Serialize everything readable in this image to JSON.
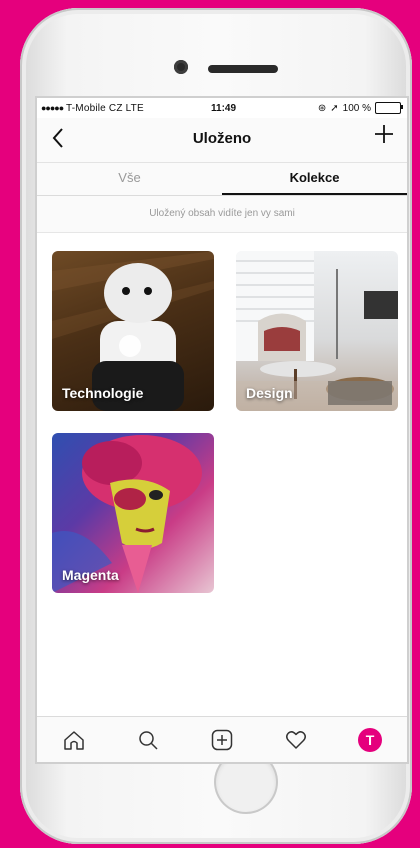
{
  "status_bar": {
    "carrier": "T-Mobile CZ",
    "network": "LTE",
    "time": "11:49",
    "battery": "100 %",
    "battery_level": 1.0
  },
  "header": {
    "back_icon": "chevron-left-icon",
    "title": "Uloženo",
    "add_icon": "plus-icon"
  },
  "tabs": [
    {
      "label": "Vše",
      "active": false
    },
    {
      "label": "Kolekce",
      "active": true
    }
  ],
  "notice": "Uložený obsah vidíte jen vy sami",
  "collections": [
    {
      "label": "Technologie"
    },
    {
      "label": "Design"
    },
    {
      "label": "Magenta"
    }
  ],
  "bottom_nav": {
    "items": [
      "home-icon",
      "search-icon",
      "add-post-icon",
      "heart-icon",
      "profile-avatar-icon"
    ],
    "accent_color": "#e5007d"
  }
}
